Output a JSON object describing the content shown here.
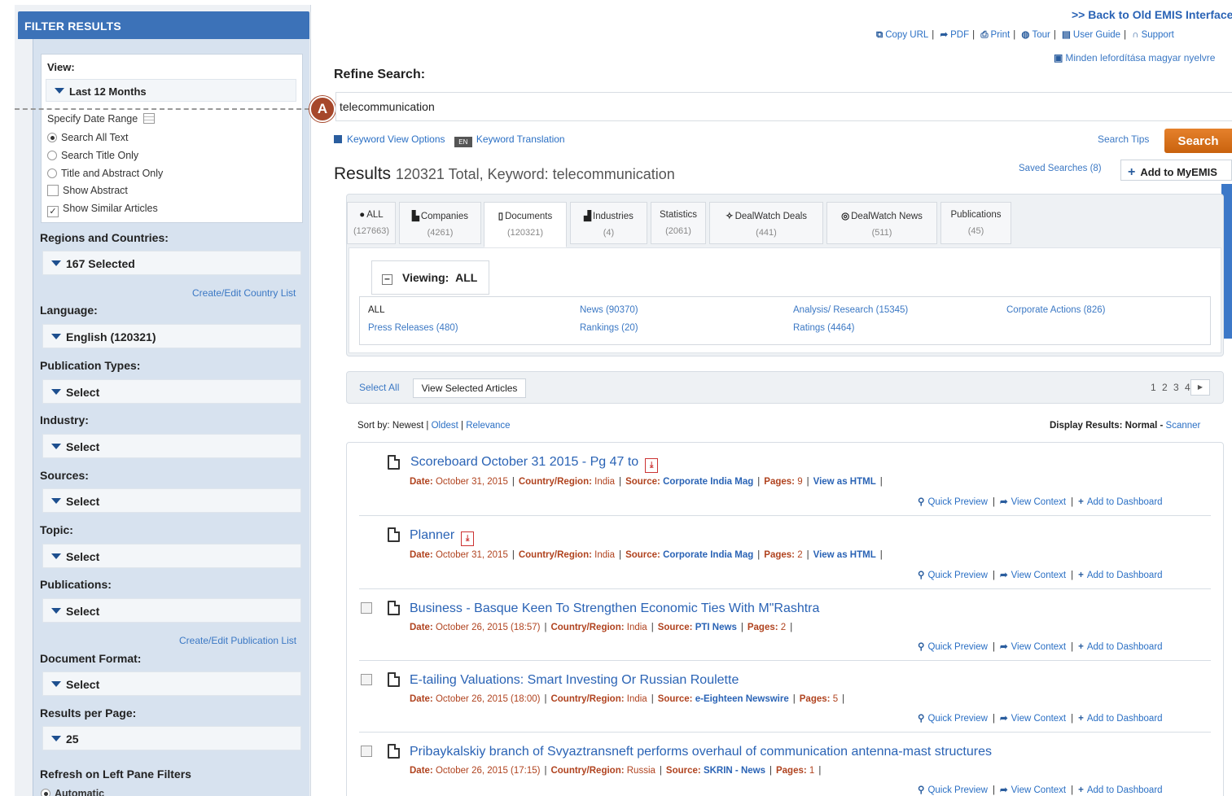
{
  "left": {
    "header": "FILTER RESULTS",
    "view_label": "View:",
    "view_value": "Last 12 Months",
    "date_range": "Specify Date Range",
    "options": [
      {
        "type": "radio",
        "label": "Search All Text",
        "checked": true
      },
      {
        "type": "radio",
        "label": "Search Title Only",
        "checked": false
      },
      {
        "type": "radio",
        "label": "Title and Abstract Only",
        "checked": false
      },
      {
        "type": "checkbox",
        "label": "Show Abstract",
        "checked": false
      },
      {
        "type": "checkbox",
        "label": "Show Similar Articles",
        "checked": true
      }
    ],
    "regions_label": "Regions and Countries:",
    "regions_value": "167 Selected",
    "country_list_link": "Create/Edit Country List",
    "language_label": "Language:",
    "language_value": "English (120321)",
    "pubtypes_label": "Publication Types:",
    "pubtypes_value": "Select",
    "industry_label": "Industry:",
    "industry_value": "Select",
    "sources_label": "Sources:",
    "sources_value": "Select",
    "topic_label": "Topic:",
    "topic_value": "Select",
    "publications_label": "Publications:",
    "publications_value": "Select",
    "pub_list_link": "Create/Edit Publication List",
    "docformat_label": "Document Format:",
    "docformat_value": "Select",
    "rpp_label": "Results per Page:",
    "rpp_value": "25",
    "refresh_label": "Refresh on Left Pane Filters",
    "refresh_option": "Automatic"
  },
  "callout": "A",
  "top": {
    "back_link": ">> Back to Old EMIS Interface",
    "toolbar": [
      "Copy URL",
      "PDF",
      "Print",
      "Tour",
      "User Guide",
      "Support"
    ],
    "translate": "Minden lefordítása magyar nyelvre"
  },
  "search": {
    "refine_label": "Refine Search:",
    "value": "telecommunication",
    "keyword_view_options": "Keyword View Options",
    "keyword_translation": "Keyword Translation",
    "search_tips": "Search Tips",
    "search_button": "Search"
  },
  "results_header": {
    "title": "Results",
    "subtitle": "120321 Total, Keyword: telecommunication",
    "saved_searches": "Saved Searches (8)",
    "add_button": "Add to MyEMIS"
  },
  "tabs": [
    {
      "label": "ALL",
      "count": "(127663)"
    },
    {
      "label": "Companies",
      "count": "(4261)"
    },
    {
      "label": "Documents",
      "count": "(120321)"
    },
    {
      "label": "Industries",
      "count": "(4)"
    },
    {
      "label": "Statistics",
      "count": "(2061)"
    },
    {
      "label": "DealWatch Deals",
      "count": "(441)"
    },
    {
      "label": "DealWatch News",
      "count": "(511)"
    },
    {
      "label": "Publications",
      "count": "(45)"
    }
  ],
  "viewing": {
    "label": "Viewing:",
    "value": "ALL"
  },
  "subcats": [
    "ALL",
    "News (90370)",
    "Analysis/ Research (15345)",
    "Corporate Actions (826)",
    "Press Releases (480)",
    "Rankings (20)",
    "Ratings (4464)"
  ],
  "select_bar": {
    "select_all": "Select All",
    "view_selected": "View Selected Articles",
    "pages": "1 2 3 4"
  },
  "sort": {
    "label": "Sort by:",
    "newest": "Newest",
    "oldest": "Oldest",
    "relevance": "Relevance"
  },
  "display": {
    "label": "Display Results: Normal -",
    "scanner": "Scanner"
  },
  "meta_labels": {
    "date": "Date:",
    "country": "Country/Region:",
    "source": "Source:",
    "pages": "Pages:",
    "html": "View as HTML"
  },
  "actions": {
    "preview": "Quick Preview",
    "context": "View Context",
    "dashboard": "Add to Dashboard"
  },
  "results": [
    {
      "title": "Scoreboard October 31 2015 - Pg 47 to",
      "date": "October 31, 2015",
      "country": "India",
      "source": "Corporate India Mag",
      "pages": "9"
    },
    {
      "title": "Planner",
      "date": "October 31, 2015",
      "country": "India",
      "source": "Corporate India Mag",
      "pages": "2"
    },
    {
      "title": "Business - Basque Keen To Strengthen Economic Ties With M\"Rashtra",
      "date": "October 26, 2015 (18:57)",
      "country": "India",
      "source": "PTI News",
      "pages": "2"
    },
    {
      "title": "E-tailing Valuations: Smart Investing Or Russian Roulette",
      "date": "October 26, 2015 (18:00)",
      "country": "India",
      "source": "e-Eighteen Newswire",
      "pages": "5"
    },
    {
      "title": "Pribaykalskiy branch of Svyaztransneft performs overhaul of communication antenna-mast structures",
      "date": "October 26, 2015 (17:15)",
      "country": "Russia",
      "source": "SKRIN - News",
      "pages": "1"
    }
  ]
}
